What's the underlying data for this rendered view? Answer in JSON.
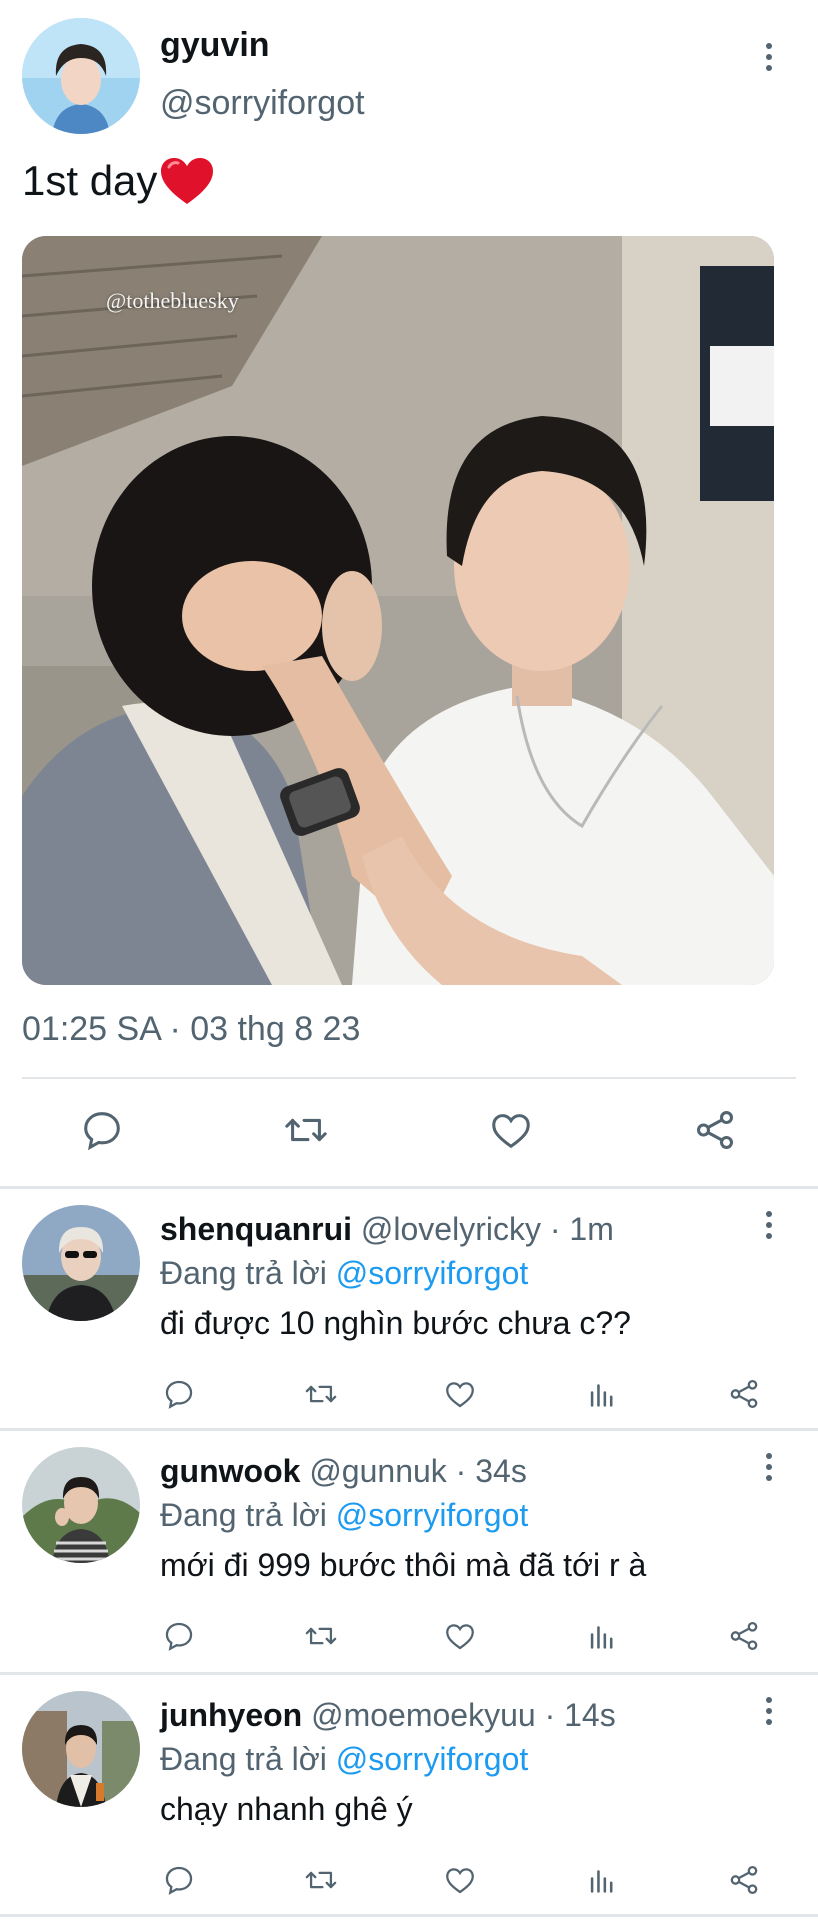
{
  "main_tweet": {
    "author_name": "gyuvin",
    "author_handle": "@sorryiforgot",
    "text": "1st day",
    "photo_watermark": "@tothebluesky",
    "timestamp": "01:25 SA · 03 thg 8 23",
    "actions": [
      "reply-icon",
      "retweet-icon",
      "like-icon",
      "share-icon"
    ]
  },
  "replies": [
    {
      "name": "shenquanrui",
      "meta": "@lovelyricky · 1m",
      "replying_prefix": "Đang trả lời ",
      "replying_to": "@sorryiforgot",
      "text": "đi được 10 nghìn bước chưa c??"
    },
    {
      "name": "gunwook",
      "meta": "@gunnuk · 34s",
      "replying_prefix": "Đang trả lời ",
      "replying_to": "@sorryiforgot",
      "text": "mới đi 999 bước thôi mà đã tới r à"
    },
    {
      "name": "junhyeon",
      "meta": "@moemoekyuu · 14s",
      "replying_prefix": "Đang trả lời ",
      "replying_to": "@sorryiforgot",
      "text": "chạy nhanh ghê ý"
    }
  ],
  "colors": {
    "text": "#0f1419",
    "secondary": "#536471",
    "mention": "#1d9bf0",
    "heart": "#e0112b",
    "divider": "#e3e6e9"
  }
}
